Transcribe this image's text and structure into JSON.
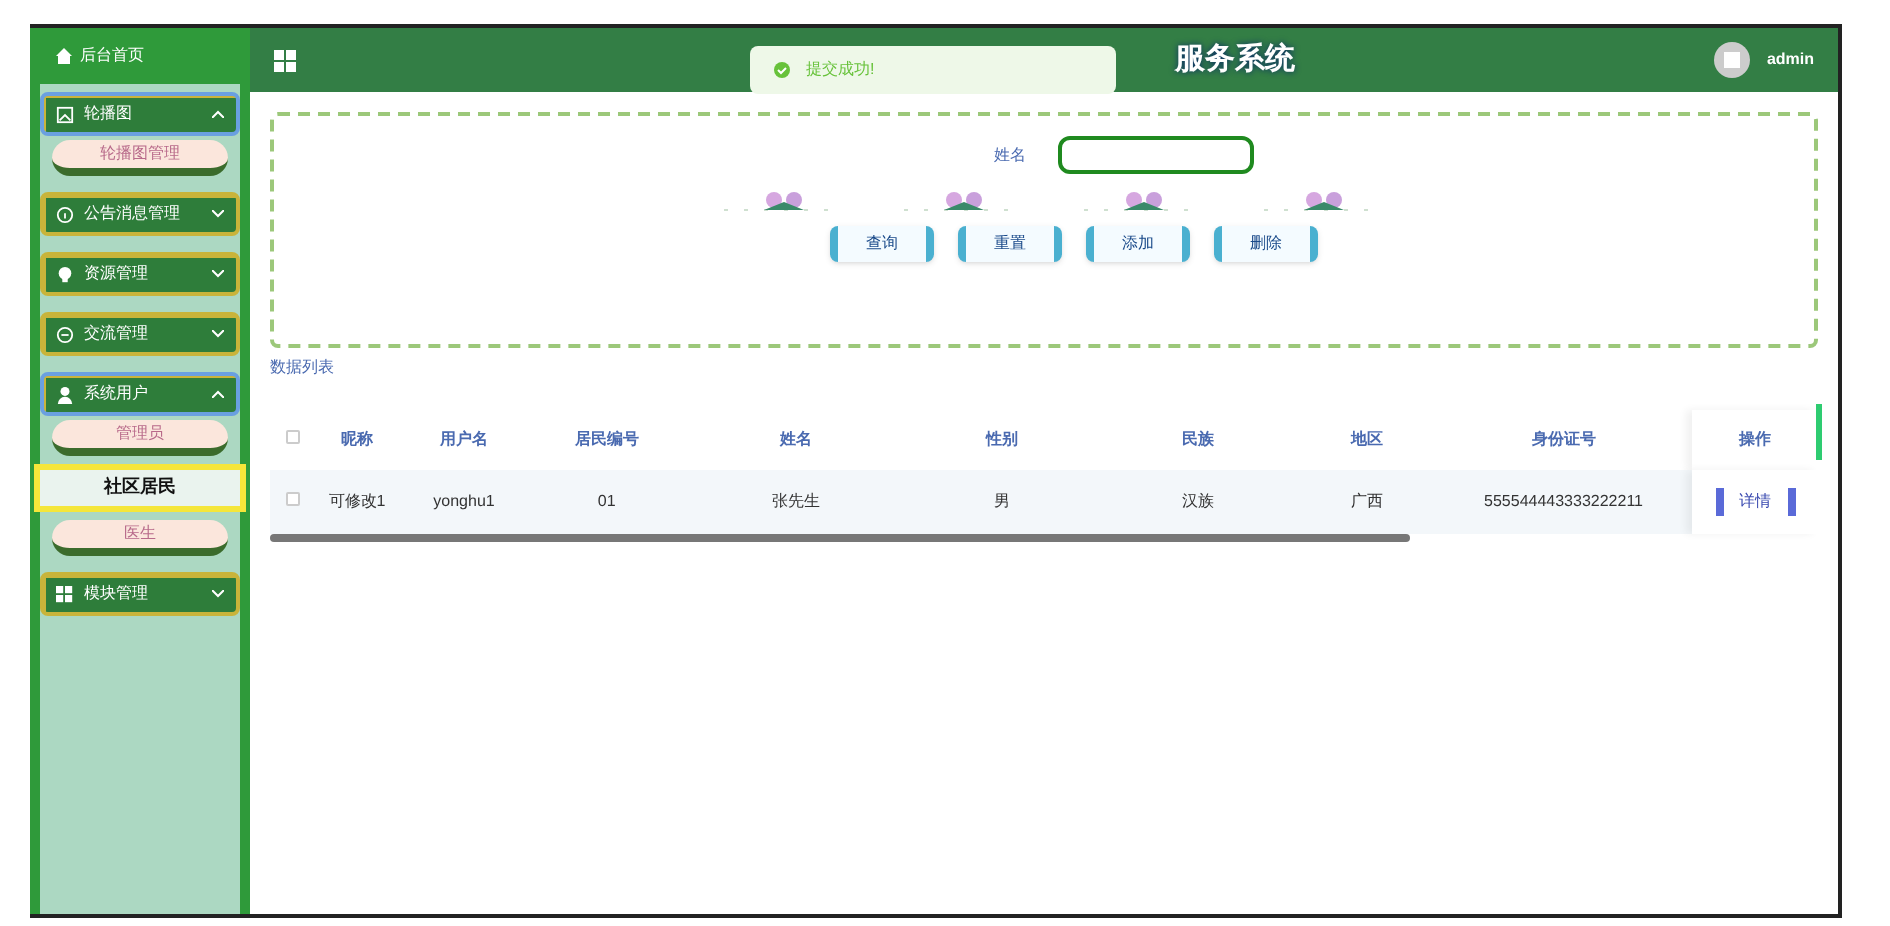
{
  "header": {
    "title": "服务系统",
    "user": "admin"
  },
  "toast": {
    "message": "提交成功!"
  },
  "sidebar": {
    "home": "后台首页",
    "items": [
      {
        "label": "轮播图",
        "expanded": true,
        "children": [
          {
            "label": "轮播图管理",
            "selected": false
          }
        ]
      },
      {
        "label": "公告消息管理",
        "expanded": false
      },
      {
        "label": "资源管理",
        "expanded": false
      },
      {
        "label": "交流管理",
        "expanded": false
      },
      {
        "label": "系统用户",
        "expanded": true,
        "children": [
          {
            "label": "管理员",
            "selected": false
          },
          {
            "label": "社区居民",
            "selected": true
          },
          {
            "label": "医生",
            "selected": false
          }
        ]
      },
      {
        "label": "模块管理",
        "expanded": false
      }
    ]
  },
  "search": {
    "label": "姓名",
    "buttons": [
      "查询",
      "重置",
      "添加",
      "删除"
    ]
  },
  "list_title": "数据列表",
  "table": {
    "all_selected": false,
    "columns": [
      "昵称",
      "用户名",
      "居民编号",
      "姓名",
      "性别",
      "民族",
      "地区",
      "身份证号",
      "操作"
    ],
    "rows": [
      {
        "selected": false,
        "cells": [
          "可修改1",
          "yonghu1",
          "01",
          "张先生",
          "男",
          "汉族",
          "广西",
          "555544443333222211"
        ],
        "action": "详情"
      }
    ]
  }
}
